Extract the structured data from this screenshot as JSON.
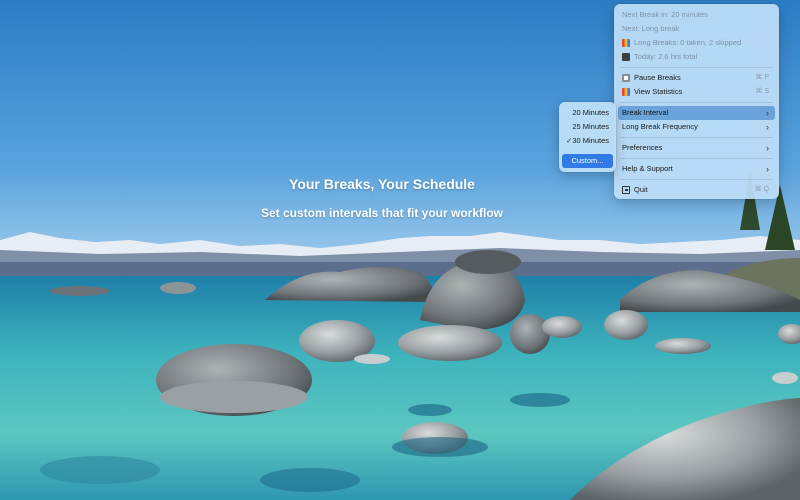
{
  "hero": {
    "title": "Your Breaks, Your Schedule",
    "subtitle": "Set custom intervals that fit your workflow"
  },
  "menu": {
    "info": [
      {
        "label": "Next Break in: 20 minutes"
      },
      {
        "label": "Next: Long break"
      },
      {
        "label": "Long Breaks: 0 taken, 2 skipped",
        "icon": "bar-chart-icon"
      },
      {
        "label": "Today: 2.6 hrs total",
        "icon": "book-icon"
      }
    ],
    "pause": {
      "label": "Pause Breaks",
      "shortcut": "⌘ P",
      "icon": "pause-icon"
    },
    "stats": {
      "label": "View Statistics",
      "shortcut": "⌘ S",
      "icon": "bar-chart-icon"
    },
    "break_interval": {
      "label": "Break Interval"
    },
    "long_freq": {
      "label": "Long Break Frequency"
    },
    "preferences": {
      "label": "Preferences"
    },
    "help": {
      "label": "Help & Support"
    },
    "quit": {
      "label": "Quit",
      "shortcut": "⌘ Q",
      "icon": "quit-icon"
    },
    "chevron": "›"
  },
  "submenu": {
    "items": [
      {
        "label": "20 Minutes"
      },
      {
        "label": "25 Minutes"
      },
      {
        "label": "30 Minutes",
        "checked": true,
        "check": "✓"
      }
    ],
    "custom": {
      "label": "Custom..."
    }
  },
  "colors": {
    "highlight": "#6aa3d9",
    "selected": "#2f7ae5",
    "menu_bg": "#bedef8"
  }
}
